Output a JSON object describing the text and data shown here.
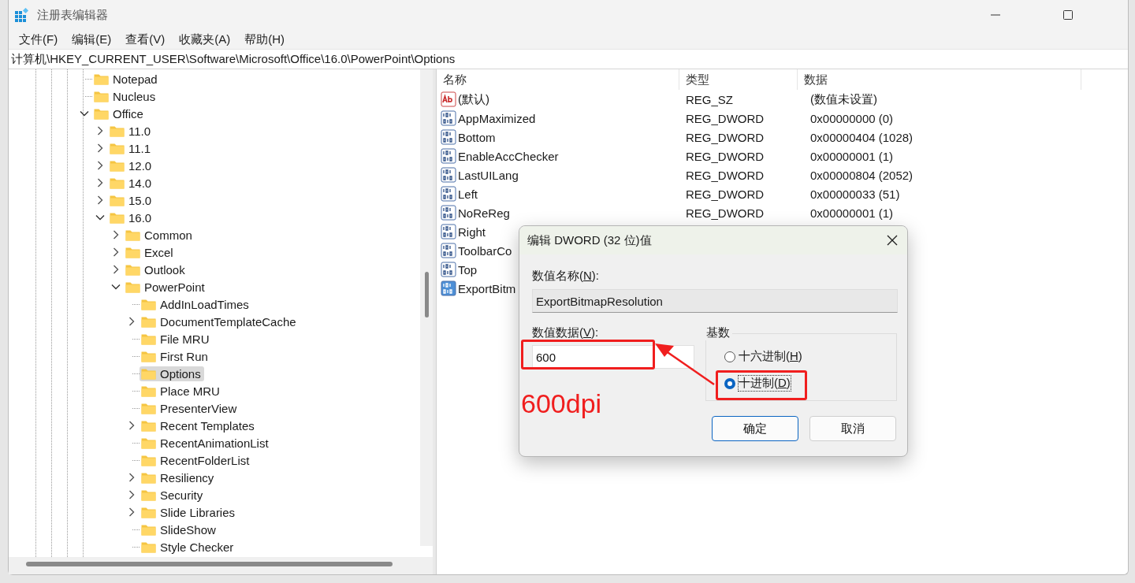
{
  "window": {
    "title": "注册表编辑器"
  },
  "menu": [
    "文件(F)",
    "编辑(E)",
    "查看(V)",
    "收藏夹(A)",
    "帮助(H)"
  ],
  "address": "计算机\\HKEY_CURRENT_USER\\Software\\Microsoft\\Office\\16.0\\PowerPoint\\Options",
  "tree": [
    {
      "label": "Notepad",
      "selected": false
    },
    {
      "label": "Nucleus",
      "selected": false
    },
    {
      "label": "Office",
      "selected": false,
      "expanded": true,
      "children": [
        {
          "label": "11.0",
          "selected": false,
          "expanded": false
        },
        {
          "label": "11.1",
          "selected": false,
          "expanded": false
        },
        {
          "label": "12.0",
          "selected": false,
          "expanded": false
        },
        {
          "label": "14.0",
          "selected": false,
          "expanded": false
        },
        {
          "label": "15.0",
          "selected": false,
          "expanded": false
        },
        {
          "label": "16.0",
          "selected": false,
          "expanded": true,
          "children": [
            {
              "label": "Common",
              "selected": false,
              "expanded": false
            },
            {
              "label": "Excel",
              "selected": false,
              "expanded": false
            },
            {
              "label": "Outlook",
              "selected": false,
              "expanded": false
            },
            {
              "label": "PowerPoint",
              "selected": false,
              "expanded": true,
              "children": [
                {
                  "label": "AddInLoadTimes",
                  "selected": false
                },
                {
                  "label": "DocumentTemplateCache",
                  "selected": false,
                  "expanded": false
                },
                {
                  "label": "File MRU",
                  "selected": false
                },
                {
                  "label": "First Run",
                  "selected": false
                },
                {
                  "label": "Options",
                  "selected": true
                },
                {
                  "label": "Place MRU",
                  "selected": false
                },
                {
                  "label": "PresenterView",
                  "selected": false
                },
                {
                  "label": "Recent Templates",
                  "selected": false,
                  "expanded": false
                },
                {
                  "label": "RecentAnimationList",
                  "selected": false
                },
                {
                  "label": "RecentFolderList",
                  "selected": false
                },
                {
                  "label": "Resiliency",
                  "selected": false,
                  "expanded": false
                },
                {
                  "label": "Security",
                  "selected": false,
                  "expanded": false
                },
                {
                  "label": "Slide Libraries",
                  "selected": false,
                  "expanded": false
                },
                {
                  "label": "SlideShow",
                  "selected": false
                },
                {
                  "label": "Style Checker",
                  "selected": false
                }
              ]
            }
          ]
        }
      ]
    }
  ],
  "values": {
    "columns": [
      "名称",
      "类型",
      "数据"
    ],
    "rows": [
      {
        "kind": "string",
        "name": "(默认)",
        "type": "REG_SZ",
        "data": "(数值未设置)",
        "selected": false
      },
      {
        "kind": "binary",
        "name": "AppMaximized",
        "type": "REG_DWORD",
        "data": "0x00000000 (0)",
        "selected": false
      },
      {
        "kind": "binary",
        "name": "Bottom",
        "type": "REG_DWORD",
        "data": "0x00000404 (1028)",
        "selected": false
      },
      {
        "kind": "binary",
        "name": "EnableAccChecker",
        "type": "REG_DWORD",
        "data": "0x00000001 (1)",
        "selected": false
      },
      {
        "kind": "binary",
        "name": "LastUILang",
        "type": "REG_DWORD",
        "data": "0x00000804 (2052)",
        "selected": false
      },
      {
        "kind": "binary",
        "name": "Left",
        "type": "REG_DWORD",
        "data": "0x00000033 (51)",
        "selected": false
      },
      {
        "kind": "binary",
        "name": "NoReReg",
        "type": "REG_DWORD",
        "data": "0x00000001 (1)",
        "selected": false
      },
      {
        "kind": "binary",
        "name": "Right",
        "selected": false
      },
      {
        "kind": "binary",
        "name": "ToolbarCo",
        "selected": false
      },
      {
        "kind": "binary",
        "name": "Top",
        "selected": false
      },
      {
        "kind": "binary",
        "name": "ExportBitm",
        "selected": true
      }
    ]
  },
  "dialog": {
    "title": "编辑 DWORD (32 位)值",
    "name_label": {
      "before": "数值名称(",
      "access_key": "N",
      "after": "):"
    },
    "name_value": "ExportBitmapResolution",
    "data_label": {
      "before": "数值数据(",
      "access_key": "V",
      "after": "):"
    },
    "data_value": "600",
    "base_title": "基数",
    "radios": [
      {
        "before": "十六进制(",
        "access_key": "H",
        "after": ")",
        "selected": false
      },
      {
        "before": "十进制(",
        "access_key": "D",
        "after": ")",
        "selected": true
      }
    ],
    "buttons": [
      {
        "label": "确定",
        "default": true
      },
      {
        "label": "取消",
        "default": false
      }
    ]
  },
  "annotation": {
    "text": "600dpi"
  }
}
